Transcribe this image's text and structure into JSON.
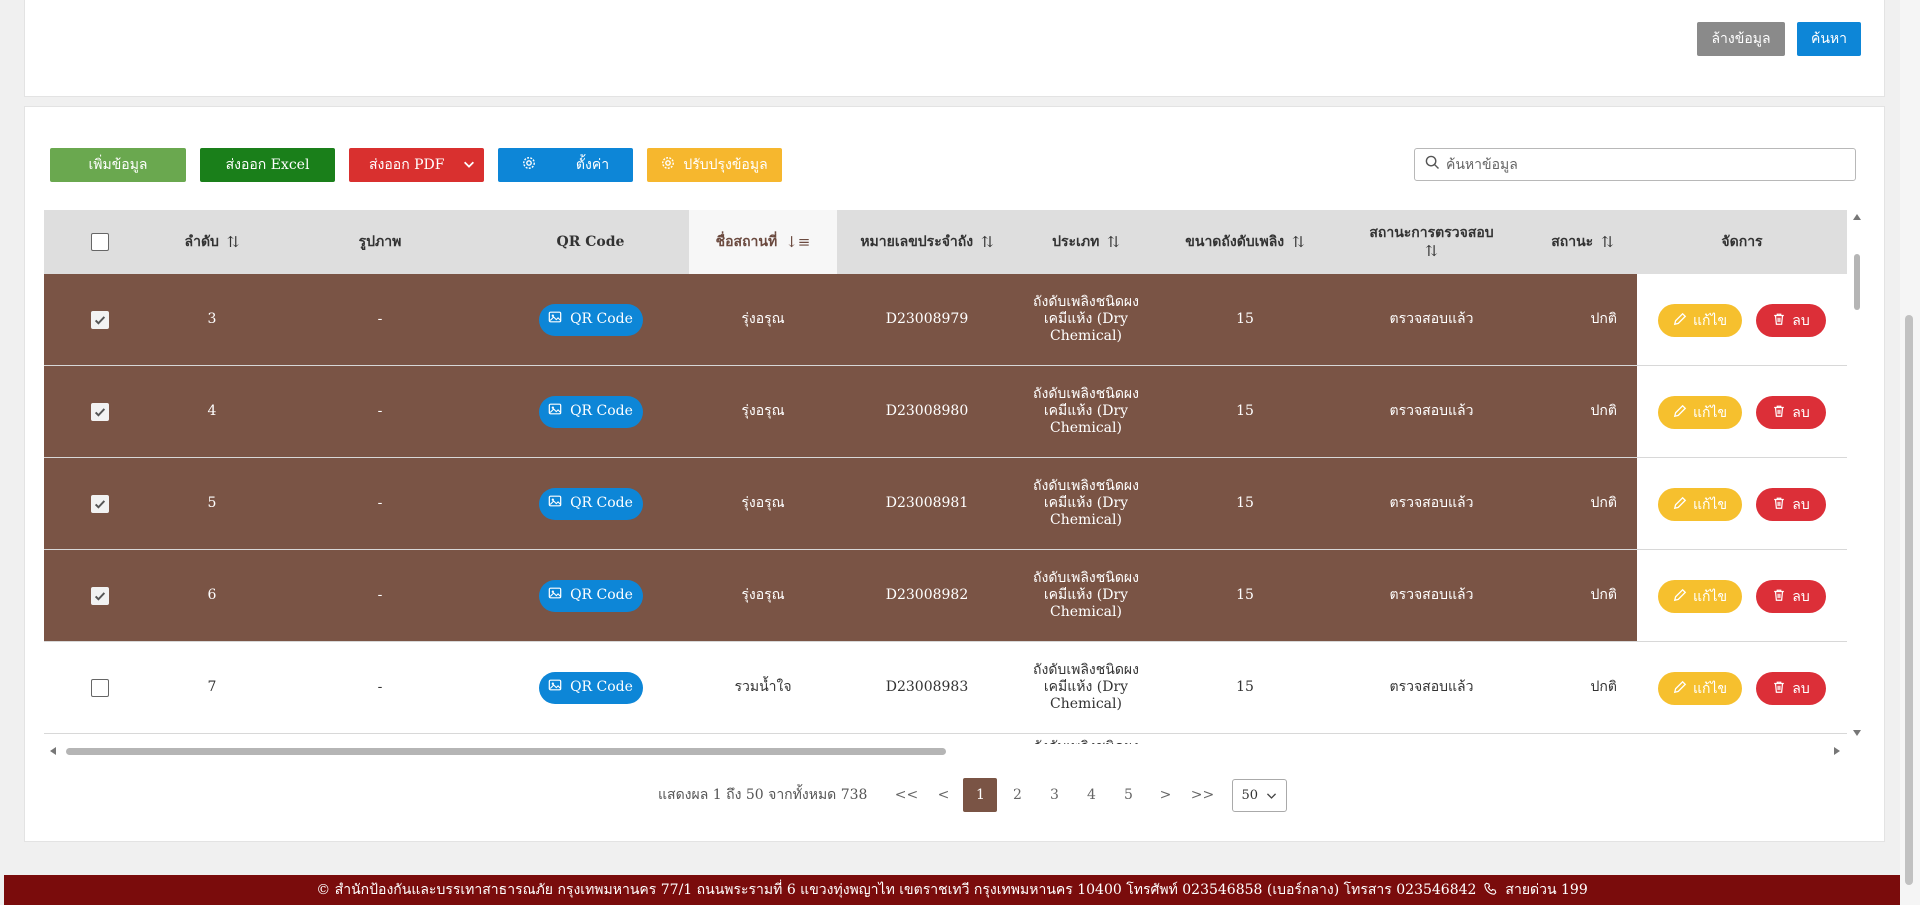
{
  "top_filters": {
    "clear_label": "ล้างข้อมูล",
    "search_label": "ค้นหา"
  },
  "toolbar": {
    "add_label": "เพิ่มข้อมูล",
    "excel_label": "ส่งออก Excel",
    "pdf_label": "ส่งออก PDF",
    "settings_label": "ตั้งค่า",
    "update_label": "ปรับปรุงข้อมูล",
    "search_placeholder": "ค้นหาข้อมูล"
  },
  "table": {
    "headers": {
      "seq": "ลำดับ",
      "image": "รูปภาพ",
      "qr": "QR Code",
      "location": "ชื่อสถานที่",
      "tank_no": "หมายเลขประจำถัง",
      "type": "ประเภท",
      "size": "ขนาดถังดับเพลิง",
      "inspect": "สถานะการตรวจสอบ",
      "status": "สถานะ",
      "manage": "จัดการ"
    },
    "qr_label": "QR Code",
    "edit_label": "แก้ไข",
    "delete_label": "ลบ",
    "rows": [
      {
        "selected": true,
        "seq": "3",
        "image": "-",
        "location": "รุ่งอรุณ",
        "tank_no": "D23008979",
        "type_l1": "ถังดับเพลิงชนิดผง",
        "type_l2": "เคมีแห้ง (Dry",
        "type_l3": "Chemical)",
        "size": "15",
        "inspect": "ตรวจสอบแล้ว",
        "status": "ปกติ"
      },
      {
        "selected": true,
        "seq": "4",
        "image": "-",
        "location": "รุ่งอรุณ",
        "tank_no": "D23008980",
        "type_l1": "ถังดับเพลิงชนิดผง",
        "type_l2": "เคมีแห้ง (Dry",
        "type_l3": "Chemical)",
        "size": "15",
        "inspect": "ตรวจสอบแล้ว",
        "status": "ปกติ"
      },
      {
        "selected": true,
        "seq": "5",
        "image": "-",
        "location": "รุ่งอรุณ",
        "tank_no": "D23008981",
        "type_l1": "ถังดับเพลิงชนิดผง",
        "type_l2": "เคมีแห้ง (Dry",
        "type_l3": "Chemical)",
        "size": "15",
        "inspect": "ตรวจสอบแล้ว",
        "status": "ปกติ"
      },
      {
        "selected": true,
        "seq": "6",
        "image": "-",
        "location": "รุ่งอรุณ",
        "tank_no": "D23008982",
        "type_l1": "ถังดับเพลิงชนิดผง",
        "type_l2": "เคมีแห้ง (Dry",
        "type_l3": "Chemical)",
        "size": "15",
        "inspect": "ตรวจสอบแล้ว",
        "status": "ปกติ"
      },
      {
        "selected": false,
        "seq": "7",
        "image": "-",
        "location": "รวมน้ำใจ",
        "tank_no": "D23008983",
        "type_l1": "ถังดับเพลิงชนิดผง",
        "type_l2": "เคมีแห้ง (Dry",
        "type_l3": "Chemical)",
        "size": "15",
        "inspect": "ตรวจสอบแล้ว",
        "status": "ปกติ"
      },
      {
        "selected": false,
        "seq": "",
        "image": "",
        "location": "",
        "tank_no": "",
        "type_l1": "ถังดับเพลิงชนิดผง",
        "type_l2": "",
        "type_l3": "",
        "size": "",
        "inspect": "",
        "status": ""
      }
    ]
  },
  "pagination": {
    "summary": "แสดงผล 1 ถึง 50 จากทั้งหมด 738",
    "first": "<<",
    "prev": "<",
    "pages": [
      "1",
      "2",
      "3",
      "4",
      "5"
    ],
    "active_page": "1",
    "next": ">",
    "last": ">>",
    "page_size": "50"
  },
  "footer": {
    "text": "© สำนักป้องกันและบรรเทาสาธารณภัย กรุงเทพมหานคร 77/1 ถนนพระรามที่ 6 แขวงทุ่งพญาไท เขตราชเทวี กรุงเทพมหานคร 10400 โทรศัพท์ 023546858 (เบอร์กลาง) โทรสาร 023546842",
    "hotline": "สายด่วน 199"
  },
  "colors": {
    "selected_row": "#7a5445",
    "add": "#6aa84f",
    "excel": "#1a7f1a",
    "pdf": "#d9302f",
    "settings": "#0d86d7",
    "update": "#f6b72e",
    "footer": "#7a0c0c"
  }
}
